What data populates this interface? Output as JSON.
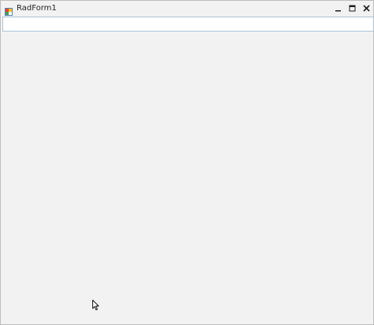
{
  "window": {
    "title": "RadForm1",
    "icon": "form-app-icon"
  },
  "titlebar": {
    "buttons": [
      {
        "name": "minimize",
        "icon": "minimize-icon"
      },
      {
        "name": "maximize",
        "icon": "maximize-icon"
      },
      {
        "name": "close",
        "icon": "close-icon"
      }
    ]
  },
  "input": {
    "value": "",
    "placeholder": ""
  },
  "colors": {
    "background": "#f2f2f2",
    "input_border": "#a9c4d9"
  }
}
